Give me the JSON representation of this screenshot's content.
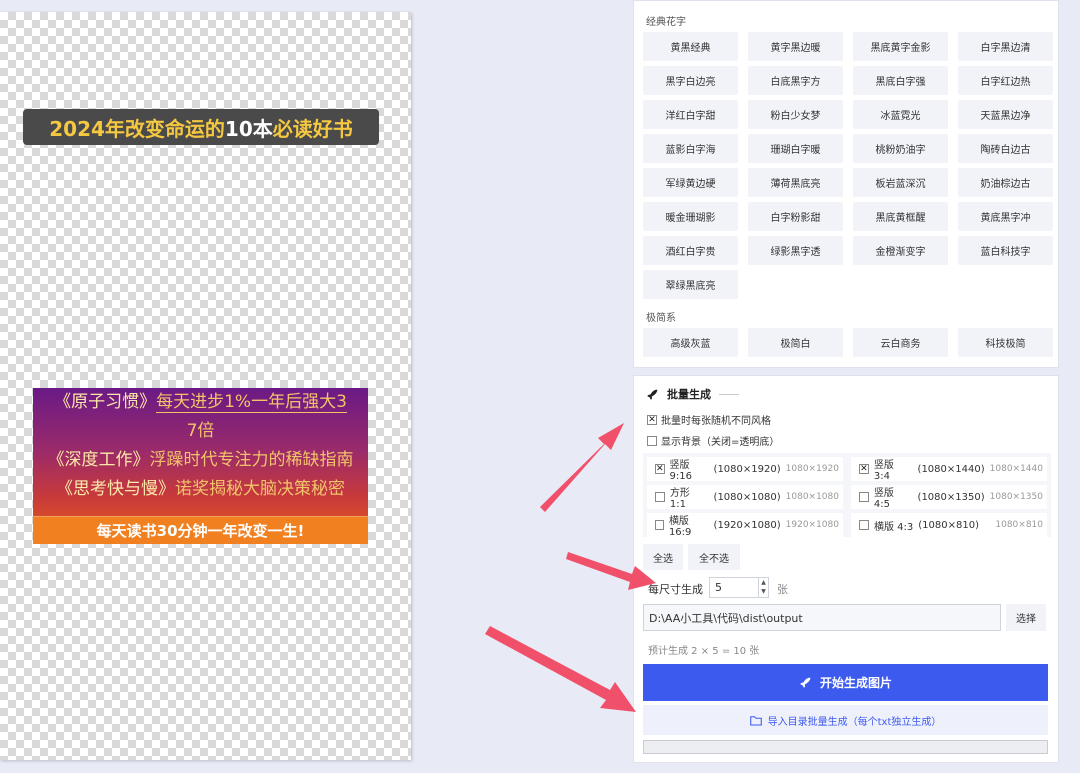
{
  "canvas": {
    "title_part1": "2024年改变命运的",
    "title_part2": "10本",
    "title_part3": "必读好书",
    "book_lines": [
      {
        "title": "《原子习惯》",
        "desc": "每天进步1%一年后强大3"
      },
      {
        "title": "",
        "desc": "7倍"
      },
      {
        "title": "《深度工作》",
        "desc": "浮躁时代专注力的稀缺指南"
      },
      {
        "title": "《思考快与慢》",
        "desc": "诺奖揭秘大脑决策秘密"
      }
    ],
    "footer": "每天读书30分钟一年改变一生!"
  },
  "styles": {
    "classic_label": "经典花字",
    "classic": [
      "黄黑经典",
      "黄字黑边暖",
      "黑底黄字金影",
      "白字黑边清",
      "黑字白边亮",
      "白底黑字方",
      "黑底白字强",
      "白字红边热",
      "洋红白字甜",
      "粉白少女梦",
      "冰蓝霓光",
      "天蓝黑边净",
      "蓝影白字海",
      "珊瑚白字暖",
      "桃粉奶油字",
      "陶砖白边古",
      "军绿黄边硬",
      "薄荷黑底亮",
      "板岩蓝深沉",
      "奶油棕边古",
      "暖金珊瑚影",
      "白字粉影甜",
      "黑底黄框醒",
      "黄底黑字冲",
      "酒红白字贵",
      "绿影黑字透",
      "金橙渐变字",
      "蓝白科技字",
      "翠绿黑底亮"
    ],
    "minimal_label": "极简系",
    "minimal": [
      "高级灰蓝",
      "极简白",
      "云白商务",
      "科技极简"
    ]
  },
  "batch": {
    "title": "批量生成",
    "random_style": "批量时每张随机不同风格",
    "show_bg": "显示背景（关闭=透明底）",
    "sizes": [
      {
        "label": "竖版 9:16",
        "dims": "(1080×1920)",
        "hint": "1080×1920",
        "checked": true
      },
      {
        "label": "竖版 3:4",
        "dims": "(1080×1440)",
        "hint": "1080×1440",
        "checked": true
      },
      {
        "label": "方形 1:1",
        "dims": "(1080×1080)",
        "hint": "1080×1080",
        "checked": false
      },
      {
        "label": "竖版 4:5",
        "dims": "(1080×1350)",
        "hint": "1080×1350",
        "checked": false
      },
      {
        "label": "横版 16:9",
        "dims": "(1920×1080)",
        "hint": "1920×1080",
        "checked": false
      },
      {
        "label": "横版 4:3",
        "dims": "(1080×810)",
        "hint": "1080×810",
        "checked": false
      }
    ],
    "select_all": "全选",
    "select_none": "全不选",
    "per_size_label": "每尺寸生成",
    "per_size_value": "5",
    "per_size_unit": "张",
    "output_path": "D:\\AA小工具\\代码\\dist\\output",
    "choose": "选择",
    "estimate": "预计生成 2 × 5 = 10 张",
    "start": "开始生成图片",
    "import": "导入目录批量生成（每个txt独立生成）"
  },
  "colors": {
    "primary": "#3d5aef",
    "arrow": "#f0506a"
  }
}
